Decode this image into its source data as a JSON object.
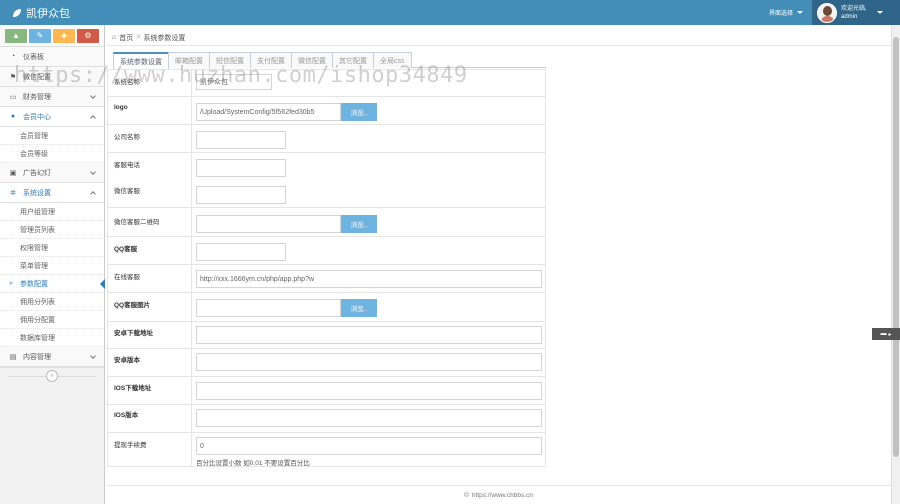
{
  "navbar": {
    "brand": "凯伊众包",
    "skin_label": "界面选择",
    "user_welcome": "欢迎光临,",
    "user_name": "admin"
  },
  "sidebar": {
    "items": [
      {
        "label": "仪表板",
        "icon": "tachometer-icon"
      },
      {
        "label": "微信配置",
        "icon": "flag-icon"
      },
      {
        "label": "财务管理",
        "icon": "money-icon"
      },
      {
        "label": "会员中心",
        "icon": "user-icon"
      },
      {
        "label": "广告幻灯",
        "icon": "picture-icon"
      },
      {
        "label": "系统设置",
        "icon": "gear-icon"
      },
      {
        "label": "内容管理",
        "icon": "book-icon"
      }
    ],
    "member_sub": [
      "会员管理",
      "会员等级"
    ],
    "system_sub": [
      "用户组管理",
      "管理员列表",
      "权限管理",
      "菜单管理",
      "参数配置",
      "佣用分列表",
      "佣用分配置",
      "数据库管理"
    ]
  },
  "breadcrumb": {
    "home": "首页",
    "separator": ">",
    "current": "系统参数设置"
  },
  "tabs": [
    "系统参数设置",
    "邮箱配置",
    "短信配置",
    "支付配置",
    "微信配置",
    "其它配置",
    "全局css"
  ],
  "form": {
    "site_name": {
      "label": "系统名称",
      "value": "凯伊众包"
    },
    "logo": {
      "label": "logo",
      "value": "/Upload/SystemConfig/5f562fed30b5",
      "button": "浏览.."
    },
    "company": {
      "label": "公司名称",
      "value": ""
    },
    "phone": {
      "label": "客服电话",
      "value": ""
    },
    "wechat_service": {
      "label": "微信客服",
      "value": ""
    },
    "wechat_qr": {
      "label": "微信客服二维码",
      "value": "",
      "button": "浏览.."
    },
    "qq_service": {
      "label": "QQ客服",
      "value": ""
    },
    "online_service": {
      "label": "在线客服",
      "value": "http://xxx.1666ym.cn/php/app.php?w"
    },
    "qq_group_img": {
      "label": "QQ客服图片",
      "value": "",
      "button": "浏览.."
    },
    "android_url": {
      "label": "安卓下载地址",
      "value": ""
    },
    "android_ver": {
      "label": "安卓版本",
      "value": ""
    },
    "ios_url": {
      "label": "IOS下载地址",
      "value": ""
    },
    "ios_ver": {
      "label": "IOS版本",
      "value": ""
    },
    "withdraw_fee": {
      "label": "提现手续费",
      "value": "0",
      "hint": "百分比设置小数 如0.01 不要设置百分比"
    }
  },
  "watermark": "https://www.huzhan.com/ishop34849",
  "footer": {
    "copyright": "©",
    "url": "https://www.chbbs.cn"
  },
  "colors": {
    "navbar": "#438eb9",
    "accent": "#2b7dbc",
    "browse_button": "#6fb3e0"
  }
}
